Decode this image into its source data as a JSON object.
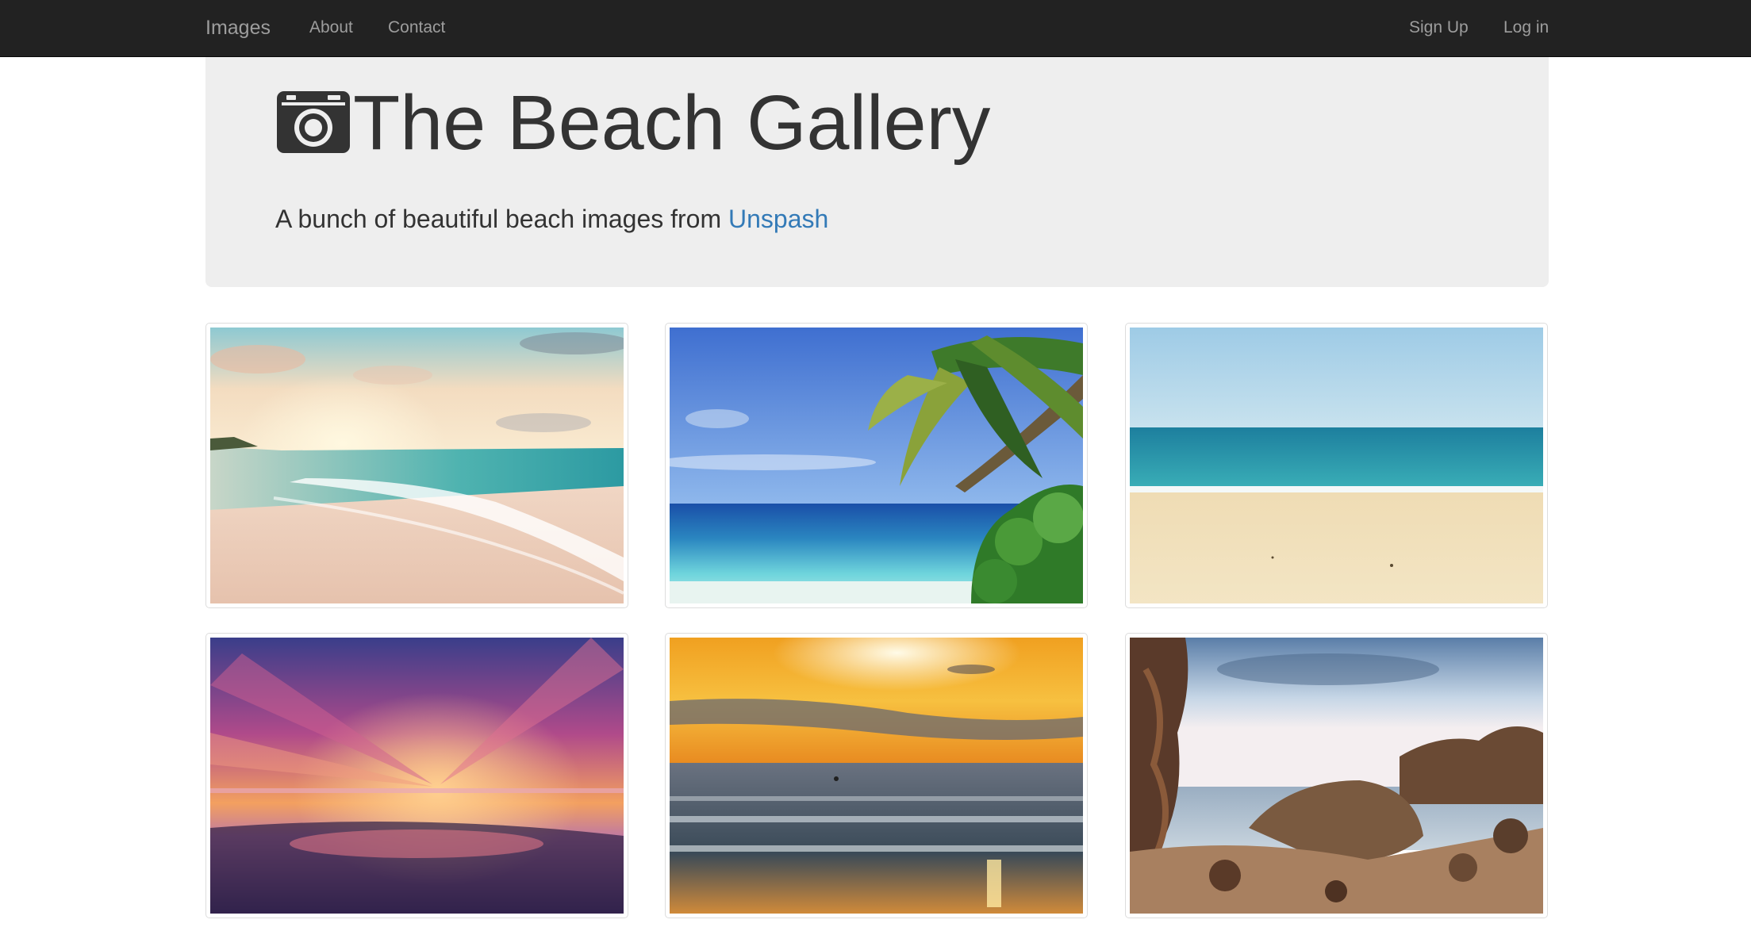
{
  "navbar": {
    "brand": "Images",
    "links": [
      {
        "label": "About"
      },
      {
        "label": "Contact"
      }
    ],
    "right_links": [
      {
        "label": "Sign Up"
      },
      {
        "label": "Log in"
      }
    ]
  },
  "jumbotron": {
    "title": "The Beach Gallery",
    "lead_prefix": "A bunch of beautiful beach images from",
    "lead_link": "Unspash",
    "icon": "camera-icon"
  },
  "colors": {
    "navbar_bg": "#222222",
    "navbar_text": "#9d9d9d",
    "jumbotron_bg": "#eeeeee",
    "link": "#337ab7",
    "text": "#333333"
  },
  "gallery": {
    "images": [
      {
        "name": "beach-sunrise-waves"
      },
      {
        "name": "palm-tree-turquoise-sea"
      },
      {
        "name": "empty-sandy-beach"
      },
      {
        "name": "purple-sunset-reflection"
      },
      {
        "name": "golden-sunset-surf"
      },
      {
        "name": "rocky-shore"
      }
    ]
  }
}
